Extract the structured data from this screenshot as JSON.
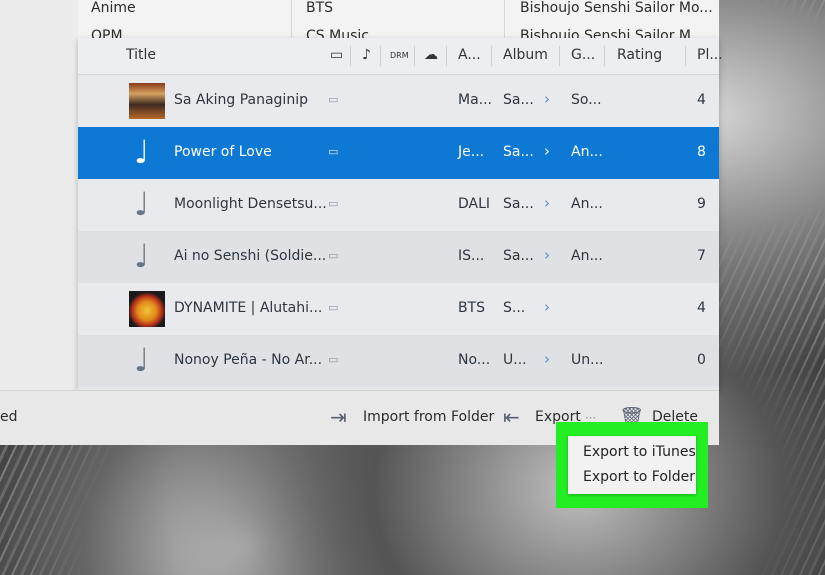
{
  "genre_strip": {
    "col1": {
      "row1": "Anime",
      "row2": "OPM"
    },
    "col2": {
      "row1": "BTS",
      "row2": "CS Music"
    },
    "col3": {
      "row1": "Bishoujo Senshi Sailor Mo...",
      "row2": "Bishoujo Senshi Sailor M..."
    }
  },
  "table": {
    "headers": {
      "title": "Title",
      "artist": "A...",
      "album": "Album",
      "genre": "G...",
      "rating": "Rating",
      "plays": "Pl..."
    },
    "header_icon_labels": {
      "drm": "DRM"
    },
    "rows": [
      {
        "title": "Sa Aking Panaginip",
        "artist": "Ma...",
        "album": "Sa...",
        "genre": "So...",
        "plays": "4",
        "art": "cover"
      },
      {
        "title": "Power of Love",
        "artist": "Je...",
        "album": "Sa...",
        "genre": "An...",
        "plays": "8",
        "art": "note"
      },
      {
        "title": "Moonlight Densetsu...",
        "artist": "DALI",
        "album": "Sa...",
        "genre": "An...",
        "plays": "9",
        "art": "note"
      },
      {
        "title": "Ai no Senshi (Soldie...",
        "artist": "IS...",
        "album": "Sa...",
        "genre": "An...",
        "plays": "7",
        "art": "note"
      },
      {
        "title": "DYNAMITE | Alutahi...",
        "artist": "BTS",
        "album": "S...",
        "genre": "",
        "plays": "4",
        "art": "cover2"
      },
      {
        "title": "Nonoy Peña - No Ar...",
        "artist": "No...",
        "album": "U...",
        "genre": "Un...",
        "plays": "0",
        "art": "note"
      }
    ]
  },
  "toolbar": {
    "left_partial": "ed",
    "import_label": "Import from Folder",
    "export_label": "Export",
    "delete_label": "Delete"
  },
  "export_menu": {
    "items": [
      "Export to iTunes",
      "Export to Folder"
    ]
  },
  "colors": {
    "selection": "#0e78d5",
    "highlight_box": "#22ee22"
  },
  "icons": {
    "note": "music-note-icon",
    "import": "import-folder-icon",
    "export": "export-icon",
    "delete": "trash-icon"
  }
}
